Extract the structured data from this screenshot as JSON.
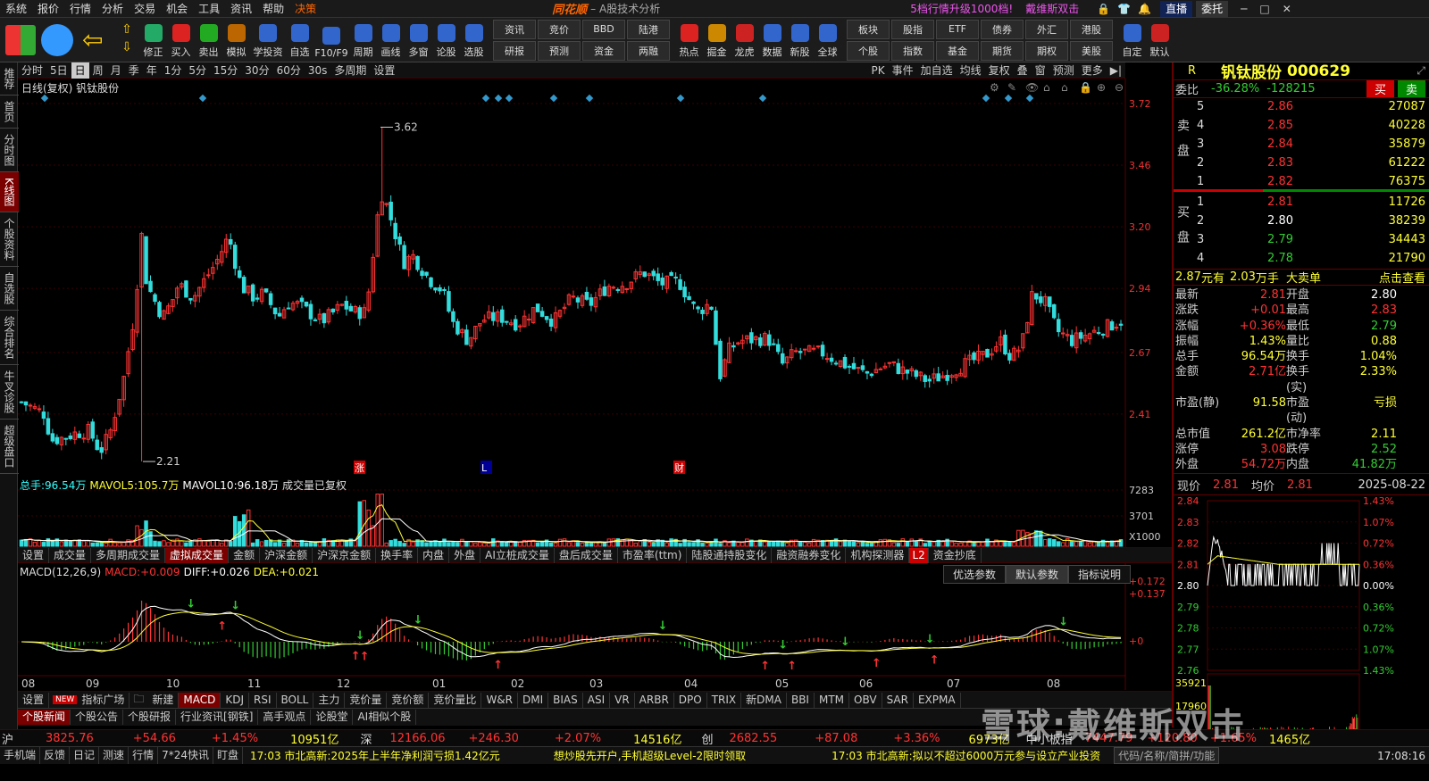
{
  "menu": [
    "系统",
    "报价",
    "行情",
    "分析",
    "交易",
    "机会",
    "工具",
    "资讯",
    "帮助",
    "决策"
  ],
  "app_title": "同花顺",
  "app_sub": "– A股技术分析",
  "promo": "5档行情升级1000档!",
  "promo_user": "戴维斯双击",
  "top_buttons": {
    "live": "直播",
    "weibi": "委托"
  },
  "toolbar": [
    "修正",
    "买入",
    "卖出",
    "模拟",
    "学投资",
    "自选",
    "F10/F9",
    "周期",
    "画线",
    "多窗",
    "论股",
    "选股"
  ],
  "toolbar_grid": [
    "资讯",
    "竞价",
    "BBD",
    "陆港",
    "研报",
    "预测",
    "资金",
    "两融"
  ],
  "toolbar2": [
    "热点",
    "掘金",
    "龙虎",
    "数据",
    "新股",
    "全球"
  ],
  "toolbar_grid2": [
    "板块",
    "股指",
    "ETF",
    "债券",
    "外汇",
    "港股",
    "个股",
    "指数",
    "基金",
    "期货",
    "期权",
    "美股"
  ],
  "toolbar3": [
    "自定",
    "默认"
  ],
  "leftnav": [
    "推荐",
    "首页",
    "分时图",
    "K线图",
    "个股资料",
    "自选股",
    "综合排名",
    "牛叉诊股",
    "超级盘口"
  ],
  "periods": [
    "分时",
    "5日",
    "日",
    "周",
    "月",
    "季",
    "年",
    "1分",
    "5分",
    "15分",
    "30分",
    "60分",
    "30s",
    "多周期",
    "设置"
  ],
  "right_tools": [
    "PK",
    "事件",
    "加自选",
    "均线",
    "复权",
    "叠",
    "窗",
    "预测",
    "更多"
  ],
  "kline": {
    "label": "日线(复权) 钒钛股份",
    "high_mark": "3.62",
    "low_mark": "2.21",
    "y_ticks": [
      "3.72",
      "3.46",
      "3.20",
      "2.94",
      "2.67",
      "2.41"
    ],
    "event_marks": [
      "涨",
      "L",
      "财"
    ]
  },
  "volume": {
    "label_total": "总手:",
    "total": "96.54万",
    "mavol5_l": "MAVOL5:",
    "mavol5": "105.7万",
    "mavol10_l": "MAVOL10:",
    "mavol10": "96.18万",
    "note": "成交量已复权",
    "y_ticks": [
      "7283",
      "3701",
      "X1000"
    ]
  },
  "vol_tabs": [
    "设置",
    "成交量",
    "多周期成交量",
    "虚拟成交量",
    "金额",
    "沪深金额",
    "沪深京金额",
    "换手率",
    "内盘",
    "外盘",
    "AI立桩成交量",
    "盘后成交量",
    "市盈率(ttm)",
    "陆股通持股变化",
    "融资融券变化",
    "机构探测器",
    "资金抄底"
  ],
  "vol_tab_l2": "L2",
  "macd": {
    "title": "MACD(12,26,9)",
    "macd_l": "MACD:",
    "macd": "+0.009",
    "diff_l": "DIFF:",
    "diff": "+0.026",
    "dea_l": "DEA:",
    "dea": "+0.021",
    "y_ticks": [
      "+0.172",
      "+0.137",
      "+0"
    ],
    "buttons": [
      "优选参数",
      "默认参数",
      "指标说明"
    ]
  },
  "months": [
    "08",
    "09",
    "10",
    "11",
    "12",
    "01",
    "02",
    "03",
    "04",
    "05",
    "06",
    "07",
    "08"
  ],
  "ind_tabs": [
    "设置",
    "指标广场",
    "新建",
    "MACD",
    "KDJ",
    "RSI",
    "BOLL",
    "主力",
    "竞价量",
    "竞价额",
    "竞价量比",
    "W&R",
    "DMI",
    "BIAS",
    "ASI",
    "VR",
    "ARBR",
    "DPO",
    "TRIX",
    "新DMA",
    "BBI",
    "MTM",
    "OBV",
    "SAR",
    "EXPMA"
  ],
  "ind_new_badge": "NEW",
  "news_tabs": [
    "个股新闻",
    "个股公告",
    "个股研报",
    "行业资讯[钢铁]",
    "高手观点",
    "论股堂",
    "AI相似个股"
  ],
  "quote": {
    "flag": "R",
    "name": "钒钛股份",
    "code": "000629",
    "weibi_l": "委比",
    "weibi": "-36.28%",
    "weicha": "-128215",
    "buy": "买",
    "sell": "卖",
    "sell_label": "卖盘",
    "buy_label": "买盘",
    "asks": [
      {
        "lv": "5",
        "p": "2.86",
        "v": "27087"
      },
      {
        "lv": "4",
        "p": "2.85",
        "v": "40228"
      },
      {
        "lv": "3",
        "p": "2.84",
        "v": "35879"
      },
      {
        "lv": "2",
        "p": "2.83",
        "v": "61222"
      },
      {
        "lv": "1",
        "p": "2.82",
        "v": "76375"
      }
    ],
    "bids": [
      {
        "lv": "1",
        "p": "2.81",
        "v": "11726"
      },
      {
        "lv": "2",
        "p": "2.80",
        "v": "38239"
      },
      {
        "lv": "3",
        "p": "2.79",
        "v": "34443"
      },
      {
        "lv": "4",
        "p": "2.78",
        "v": "21790"
      }
    ],
    "bigorder": {
      "p": "2.87",
      "u1": "元有",
      "v": "2.03",
      "u2": "万手",
      "l1": "大卖单",
      "l2": "点击查看"
    },
    "stats": [
      [
        "最新",
        "2.81",
        "开盘",
        "2.80"
      ],
      [
        "涨跌",
        "+0.01",
        "最高",
        "2.83"
      ],
      [
        "涨幅",
        "+0.36%",
        "最低",
        "2.79"
      ],
      [
        "振幅",
        "1.43%",
        "量比",
        "0.88"
      ],
      [
        "总手",
        "96.54万",
        "换手",
        "1.04%"
      ],
      [
        "金额",
        "2.71亿",
        "换手(实)",
        "2.33%"
      ],
      [
        "市盈(静)",
        "91.58",
        "市盈(动)",
        "亏损"
      ],
      [
        "总市值",
        "261.2亿",
        "市净率",
        "2.11"
      ],
      [
        "涨停",
        "3.08",
        "跌停",
        "2.52"
      ],
      [
        "外盘",
        "54.72万",
        "内盘",
        "41.82万"
      ]
    ]
  },
  "mini": {
    "now_l": "现价",
    "now": "2.81",
    "avg_l": "均价",
    "avg": "2.81",
    "date": "2025-08-22",
    "left_ticks": [
      "2.84",
      "2.83",
      "2.82",
      "2.81",
      "2.80",
      "2.79",
      "2.78",
      "2.77",
      "2.76"
    ],
    "right_ticks": [
      "1.43%",
      "1.07%",
      "0.72%",
      "0.36%",
      "0.00%",
      "0.36%",
      "0.72%",
      "1.07%",
      "1.43%"
    ],
    "vol_ticks": [
      "35921",
      "17960"
    ]
  },
  "ticker": {
    "sh_l": "沪",
    "sh": "3825.76",
    "sh_c": "+54.66",
    "sh_p": "+1.45%",
    "sh_a": "10951亿",
    "sz_l": "深",
    "sz": "12166.06",
    "sz_c": "+246.30",
    "sz_p": "+2.07%",
    "sz_a": "14516亿",
    "cy_l": "创",
    "cy": "2682.55",
    "cy_c": "+87.08",
    "cy_p": "+3.36%",
    "cy_a": "6973亿",
    "zx_l": "中小板指",
    "zx": "7447.79",
    "zx_c": "+120.80",
    "zx_p": "+1.65%",
    "zx_a": "1465亿"
  },
  "status": {
    "items": [
      "手机端",
      "反馈",
      "日记",
      "测速",
      "行情",
      "7*24快讯",
      "盯盘"
    ],
    "news1": "17:03 市北高新:2025年上半年净利润亏损1.42亿元",
    "news2": "想炒股先开户,手机超级Level-2限时领取",
    "news3": "17:03 市北高新:拟以不超过6000万元参与设立产业投资",
    "search": "代码/名称/简拼/功能",
    "time": "17:08:16"
  },
  "watermark": "雪球:戴维斯双击",
  "colors": {
    "up": "#ff3333",
    "down": "#33dddd",
    "ma_white": "#ffffff",
    "ma_yellow": "#ffff33",
    "bg": "#000000",
    "grid_red": "#5a0000"
  }
}
